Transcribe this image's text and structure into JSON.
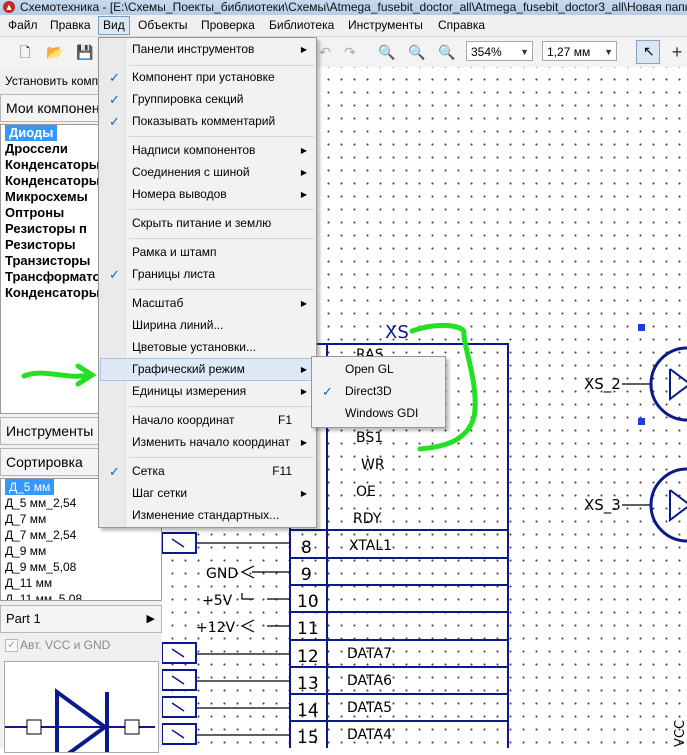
{
  "window": {
    "title": "Схемотехника - [E:\\Схемы_Поекты_библиотеки\\Схемы\\Atmega_fusebit_doctor_all\\Atmega_fusebit_doctor3_all\\Новая папка"
  },
  "menubar": [
    "Файл",
    "Правка",
    "Вид",
    "Объекты",
    "Проверка",
    "Библиотека",
    "Инструменты",
    "Справка"
  ],
  "toolbar": {
    "zoom": "354%",
    "grid": "1,27 мм"
  },
  "left_panel": {
    "install_label": "Установить компоненты",
    "my_components": "Мои компоненты",
    "categories": [
      "Диоды",
      "Дроссели",
      "Конденсаторы",
      "Конденсаторы",
      "Микросхемы",
      "Оптроны",
      "Резисторы п",
      "Резисторы",
      "Транзисторы",
      "Трансформаторы",
      "Конденсаторы"
    ],
    "tools_label": "Инструменты",
    "sort_label": "Сортировка",
    "parts": [
      "Д_5 мм",
      "Д_5 мм_2,54",
      "Д_7 мм",
      "Д_7 мм_2,54",
      "Д_9 мм",
      "Д_9 мм_5,08",
      "Д_11 мм",
      "Д_11 мм_5,08"
    ],
    "part_selector": "Part 1",
    "auto_vcc": "Авт. VCC и GND"
  },
  "view_menu": [
    {
      "label": "Панели инструментов",
      "submenu": true
    },
    {
      "sep": true
    },
    {
      "label": "Компонент при установке",
      "checked": true
    },
    {
      "label": "Группировка секций",
      "checked": true
    },
    {
      "label": "Показывать комментарий",
      "checked": true
    },
    {
      "sep": true
    },
    {
      "label": "Надписи компонентов",
      "submenu": true
    },
    {
      "label": "Соединения с шиной",
      "submenu": true
    },
    {
      "label": "Номера выводов",
      "submenu": true
    },
    {
      "sep": true
    },
    {
      "label": "Скрыть питание и землю"
    },
    {
      "sep": true
    },
    {
      "label": "Рамка и штамп"
    },
    {
      "label": "Границы листа",
      "checked": true
    },
    {
      "sep": true
    },
    {
      "label": "Масштаб",
      "submenu": true
    },
    {
      "label": "Ширина линий..."
    },
    {
      "label": "Цветовые установки..."
    },
    {
      "label": "Графический режим",
      "submenu": true,
      "highlighted": true
    },
    {
      "label": "Единицы измерения",
      "submenu": true
    },
    {
      "sep": true
    },
    {
      "label": "Начало координат",
      "shortcut": "F1"
    },
    {
      "label": "Изменить начало координат",
      "submenu": true
    },
    {
      "sep": true
    },
    {
      "label": "Сетка",
      "shortcut": "F11",
      "checked": true
    },
    {
      "label": "Шаг сетки",
      "submenu": true
    },
    {
      "label": "Изменение стандартных..."
    }
  ],
  "graphics_submenu": [
    {
      "label": "Open GL"
    },
    {
      "label": "Direct3D",
      "checked": true
    },
    {
      "label": "Windows GDI"
    }
  ],
  "schematic": {
    "connector": "XS",
    "connectors_right": [
      "XS_2",
      "XS_3"
    ],
    "pin_labels": [
      "RAS",
      "BS1",
      "WR",
      "OE",
      "RDY",
      "XTAL1",
      "DATA7",
      "DATA6",
      "DATA5",
      "DATA4"
    ],
    "pin_numbers": [
      "8",
      "9",
      "10",
      "11",
      "12",
      "13",
      "14",
      "15"
    ],
    "power_labels": [
      "GND",
      "+5V",
      "+12V"
    ],
    "vcc_label": "VCC"
  },
  "colors": {
    "schematic": "#0a1a8c",
    "annotation": "#22e022",
    "selection": "#3399ff"
  }
}
